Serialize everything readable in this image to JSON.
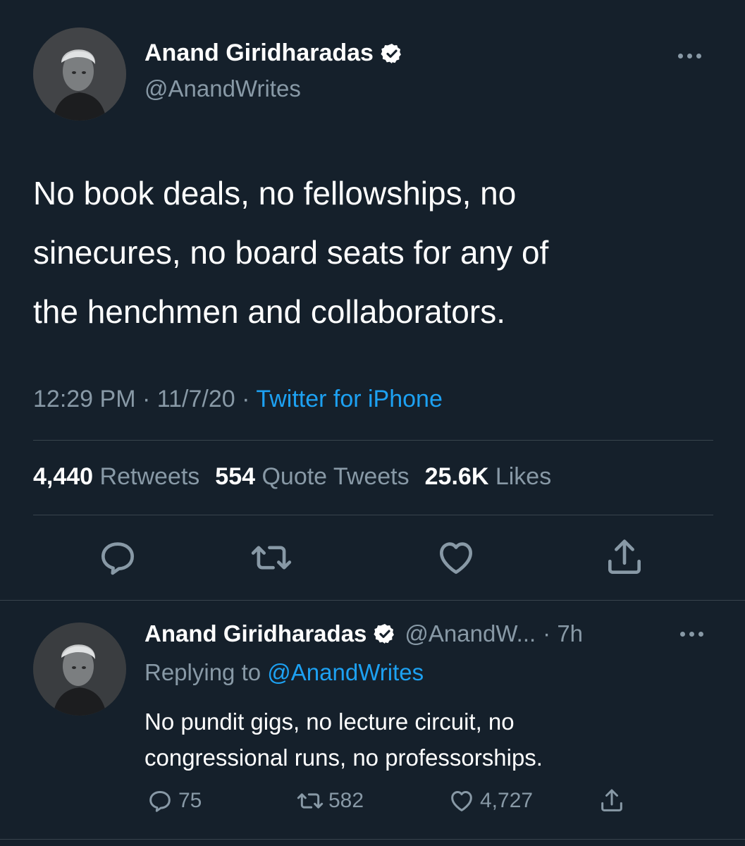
{
  "main_tweet": {
    "author_name": "Anand Giridharadas",
    "handle": "@AnandWrites",
    "text_lines": [
      "No book deals, no fellowships, no",
      "sinecures, no board seats for any of",
      "the henchmen and collaborators."
    ],
    "time": "12:29 PM",
    "date": "11/7/20",
    "separator": "·",
    "source": "Twitter for iPhone",
    "stats": {
      "retweets_count": "4,440",
      "retweets_label": "Retweets",
      "quotes_count": "554",
      "quotes_label": "Quote Tweets",
      "likes_count": "25.6K",
      "likes_label": "Likes"
    },
    "actions": [
      "reply-icon",
      "retweet-icon",
      "like-icon",
      "share-icon"
    ]
  },
  "reply_tweet": {
    "author_name": "Anand Giridharadas",
    "handle": "@AnandW...",
    "time": "· 7h",
    "replying_prefix": "Replying to",
    "replying_to": "@AnandWrites",
    "text_lines": [
      "No pundit gigs, no lecture circuit, no",
      "congressional runs, no professorships."
    ],
    "reply_count": "75",
    "retweet_count": "582",
    "like_count": "4,727"
  },
  "colors": {
    "background": "#15202b",
    "text": "#ffffff",
    "secondary_text": "#8899a6",
    "link": "#1da1f2",
    "divider": "#38444d"
  }
}
